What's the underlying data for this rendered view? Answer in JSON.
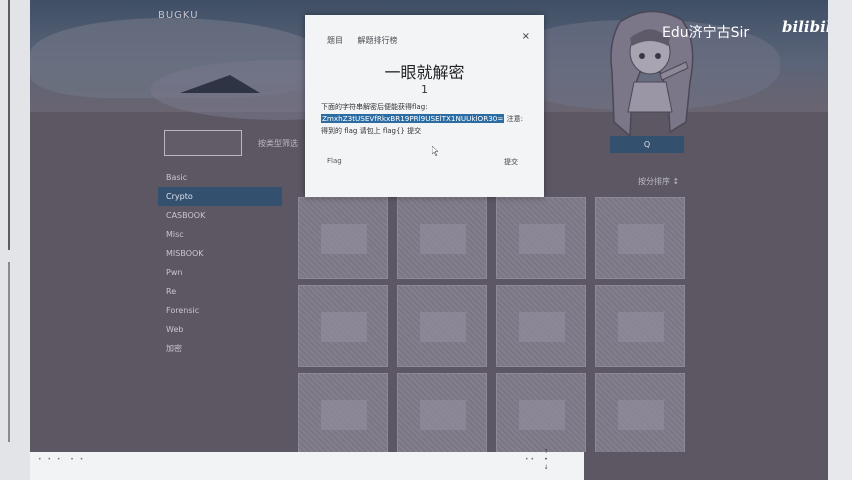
{
  "site": {
    "logo": "BUGKU"
  },
  "search": {
    "value": "",
    "placeholder": "",
    "type_label": "按类型筛选",
    "button_label": "Q"
  },
  "categories": [
    {
      "label": "Basic",
      "active": false
    },
    {
      "label": "Crypto",
      "active": true
    },
    {
      "label": "CASBOOK",
      "active": false
    },
    {
      "label": "Misc",
      "active": false
    },
    {
      "label": "MISBOOK",
      "active": false
    },
    {
      "label": "Pwn",
      "active": false
    },
    {
      "label": "Re",
      "active": false
    },
    {
      "label": "Forensic",
      "active": false
    },
    {
      "label": "Web",
      "active": false
    },
    {
      "label": "加密",
      "active": false
    }
  ],
  "score_label": "按分排序 ↕",
  "grid": {
    "rows": 3,
    "cols": 4
  },
  "modal": {
    "tab_question": "题目",
    "tab_solves": "解题排行榜",
    "close": "×",
    "title": "一眼就解密",
    "score": "1",
    "desc_prefix": "下面的字符串解密后便能获得flag:",
    "cipher": "ZmxhZ3tUSEVfRkxBR19PRl9USElTX1NUUklOR30=",
    "desc_suffix": "注意: 得到的 flag 请包上 flag{} 提交",
    "flag_label": "Flag",
    "submit_label": "提交"
  },
  "watermark": {
    "text": "Edu济宁古Sir",
    "logo": "bilibili"
  },
  "colors": {
    "accent": "#34506f",
    "modal_bg": "#f3f4f6",
    "page_bg": "#5d5763",
    "cipher_highlight": "#2c6ca2"
  }
}
